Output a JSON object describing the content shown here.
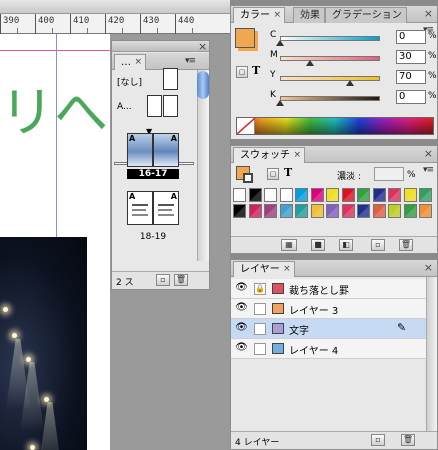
{
  "ruler": {
    "marks": [
      "390",
      "400",
      "410",
      "420",
      "430",
      "440"
    ]
  },
  "canvas": {
    "green_text": "リへ"
  },
  "pages": {
    "tab_label": "…",
    "master_none": "[なし]",
    "master_a": "A...",
    "spread1_label": "16-17",
    "spread2_label": "18-19",
    "footer_count": "2 ス",
    "page_letter": "A"
  },
  "color": {
    "tabs": [
      "カラー",
      "効果",
      "グラデーション"
    ],
    "fill_color": "#f0a850",
    "channels": [
      {
        "name": "C",
        "value": "0",
        "knob": 0.0,
        "gradient": [
          "#ffffff",
          "#00a0c8"
        ]
      },
      {
        "name": "M",
        "value": "30",
        "knob": 0.3,
        "gradient": [
          "#f6e4c8",
          "#e06080"
        ]
      },
      {
        "name": "Y",
        "value": "70",
        "knob": 0.7,
        "gradient": [
          "#fbe0c8",
          "#f0c020"
        ]
      },
      {
        "name": "K",
        "value": "0",
        "knob": 0.0,
        "gradient": [
          "#f4c890",
          "#201810"
        ]
      }
    ],
    "percent": "%"
  },
  "swatch": {
    "tab": "スウォッチ",
    "tint_label": "濃淡 :",
    "percent": "%",
    "colors_row1": [
      "#ffffff",
      "#000000",
      "#ffffff",
      "#ffffff",
      "#00a0e0",
      "#e0007a",
      "#f0e020",
      "#e01020",
      "#30a040",
      "#203090",
      "#e03060",
      "#f0e020",
      "#30a060"
    ],
    "colors_row2": [
      "#000000",
      "#d02060",
      "#a04080",
      "#40a0d0",
      "#20a0a0",
      "#f0c030",
      "#8060c0",
      "#e03060",
      "#203090",
      "#e06040",
      "#c0d020",
      "#30a040",
      "#f09030"
    ]
  },
  "layers": {
    "tab": "レイヤー",
    "items": [
      {
        "name": "裁ち落とし罫",
        "color": "#e05060",
        "locked": true,
        "selected": false
      },
      {
        "name": "レイヤー 3",
        "color": "#f0a060",
        "locked": false,
        "selected": false
      },
      {
        "name": "文字",
        "color": "#a8a0d0",
        "locked": false,
        "selected": true
      },
      {
        "name": "レイヤー 4",
        "color": "#70b0e0",
        "locked": false,
        "selected": false
      }
    ],
    "footer": "4 レイヤー"
  }
}
